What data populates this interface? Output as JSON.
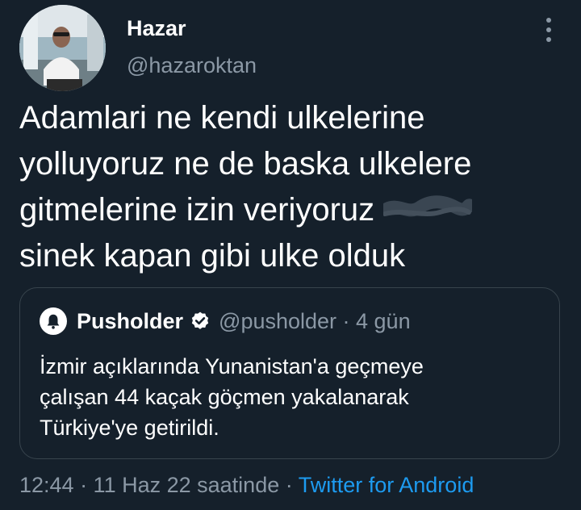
{
  "author": {
    "name": "Hazar",
    "handle": "@hazaroktan"
  },
  "tweet": {
    "lines": [
      "Adamlari ne kendi ulkelerine",
      "yolluyoruz ne de baska ulkelere",
      "gitmelerine izin veriyoruz",
      "sinek kapan gibi ulke olduk"
    ]
  },
  "quoted": {
    "name": "Pusholder",
    "handle_time": "@pusholder · 4 gün",
    "text_lines": [
      "İzmir açıklarında Yunanistan'a geçmeye",
      "çalışan 44 kaçak göçmen yakalanarak",
      "Türkiye'ye getirildi."
    ]
  },
  "meta": {
    "time_date": "12:44 · 11 Haz 22 saatinde · ",
    "source": "Twitter for Android"
  },
  "colors": {
    "background": "#15202b",
    "secondary_text": "#8b98a5",
    "link": "#1d9bf0",
    "verified_badge": "#ffffff"
  },
  "icons": [
    "more-vertical-icon",
    "verified-badge-icon",
    "bell-icon"
  ]
}
